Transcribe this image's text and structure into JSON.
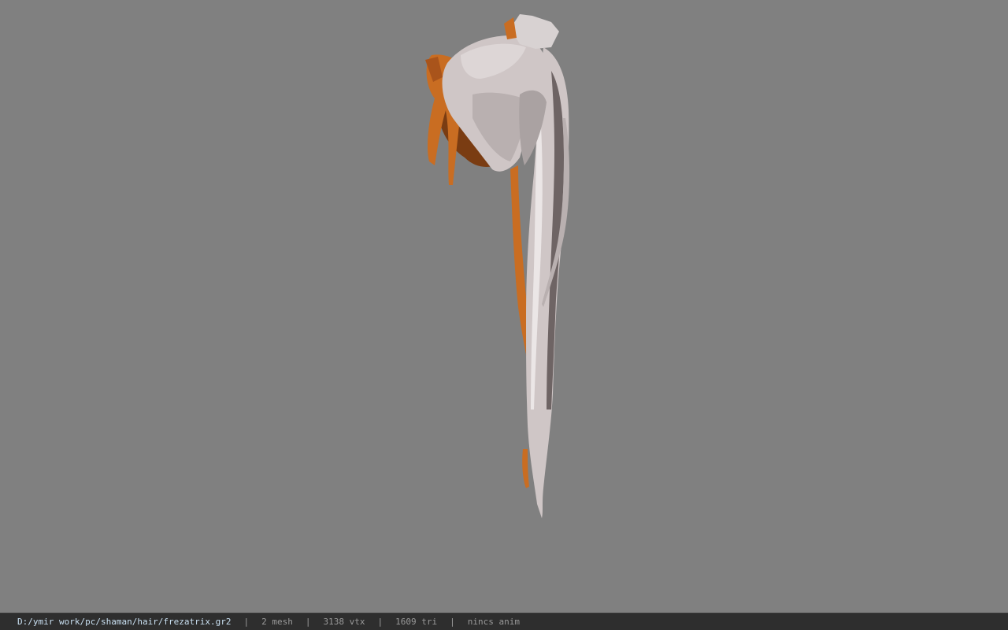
{
  "status_bar": {
    "file_path": "D:/ymir work/pc/shaman/hair/frezatrix.gr2",
    "separator": "|",
    "mesh_count": "2 mesh",
    "vertex_count": "3138 vtx",
    "triangle_count": "1609 tri",
    "anim_status": "nincs anim"
  },
  "colors": {
    "viewport_background": "#808080",
    "status_bar_background": "#2e2e2e",
    "path_text": "#c9e0f2",
    "stat_text": "#9a9a9a",
    "hair_silver": "#cfc6c6",
    "hair_orange": "#c96d22",
    "hair_brown": "#7a3c12"
  },
  "viewport": {
    "model": "3d-hair-mesh"
  }
}
